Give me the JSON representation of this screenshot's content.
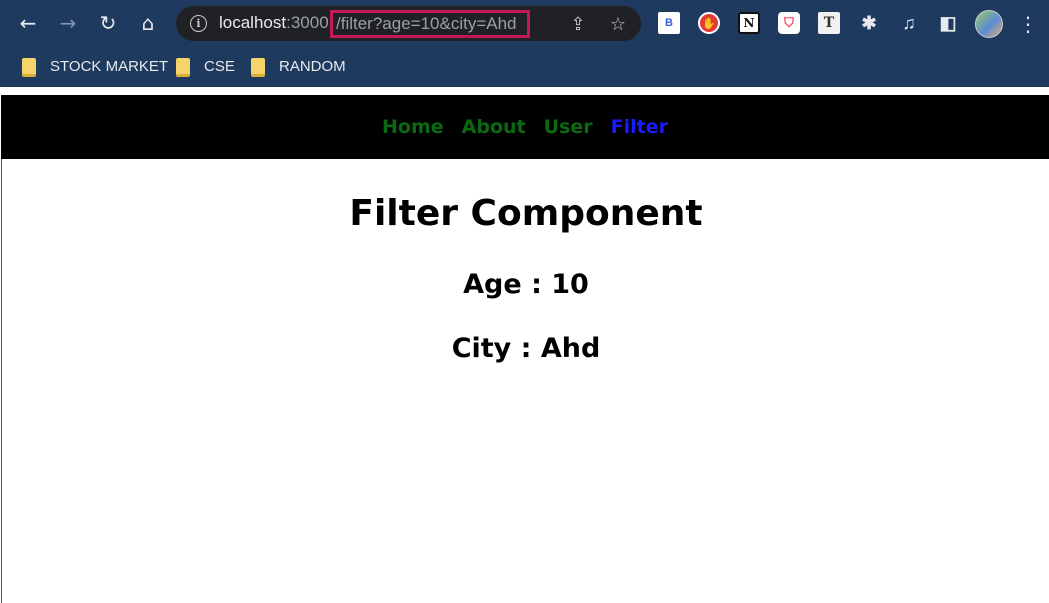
{
  "browser": {
    "address": {
      "host": "localhost",
      "port": ":3000",
      "path": "/filter?age=10&city=Ahd"
    },
    "extensions": [
      "B",
      "✋",
      "N",
      "⛉",
      "T"
    ],
    "bookmarks": [
      "STOCK MARKET",
      "CSE",
      "RANDOM"
    ]
  },
  "nav": {
    "links": [
      {
        "label": "Home"
      },
      {
        "label": "About"
      },
      {
        "label": "User"
      },
      {
        "label": "Filter"
      }
    ],
    "active": "Filter"
  },
  "page": {
    "title": "Filter Component",
    "age_line": "Age : 10",
    "city_line": "City : Ahd"
  },
  "colors": {
    "nav_link": "#0a6a12",
    "nav_active": "#1a1aff",
    "chrome": "#1f3a5f",
    "url_highlight": "#c2185b"
  }
}
